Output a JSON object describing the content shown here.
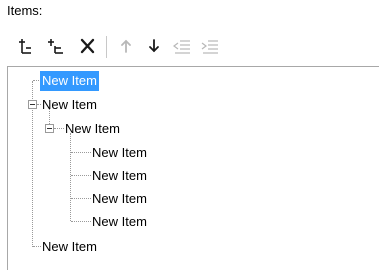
{
  "panel": {
    "caption": "Items:"
  },
  "toolbar": {
    "buttons": [
      {
        "icon": "add-item-icon",
        "enabled": true
      },
      {
        "icon": "add-child-item-icon",
        "enabled": true
      },
      {
        "icon": "delete-icon",
        "enabled": true
      },
      {
        "icon": "move-up-icon",
        "enabled": false
      },
      {
        "icon": "move-down-icon",
        "enabled": true
      },
      {
        "icon": "outdent-icon",
        "enabled": false
      },
      {
        "icon": "indent-icon",
        "enabled": false
      }
    ]
  },
  "tree": {
    "items": [
      {
        "label": "New Item",
        "level": 0,
        "selected": true,
        "expanded": false
      },
      {
        "label": "New Item",
        "level": 0,
        "selected": false,
        "expanded": true
      },
      {
        "label": "New Item",
        "level": 1,
        "selected": false,
        "expanded": true
      },
      {
        "label": "New Item",
        "level": 2,
        "selected": false,
        "expanded": false
      },
      {
        "label": "New Item",
        "level": 2,
        "selected": false,
        "expanded": false
      },
      {
        "label": "New Item",
        "level": 2,
        "selected": false,
        "expanded": false
      },
      {
        "label": "New Item",
        "level": 2,
        "selected": false,
        "expanded": false
      },
      {
        "label": "New Item",
        "level": 0,
        "selected": false,
        "expanded": false
      }
    ]
  },
  "colors": {
    "selection": "#3399ff",
    "icon_enabled": "#1a1a1a",
    "icon_disabled": "#b8b8b8"
  }
}
